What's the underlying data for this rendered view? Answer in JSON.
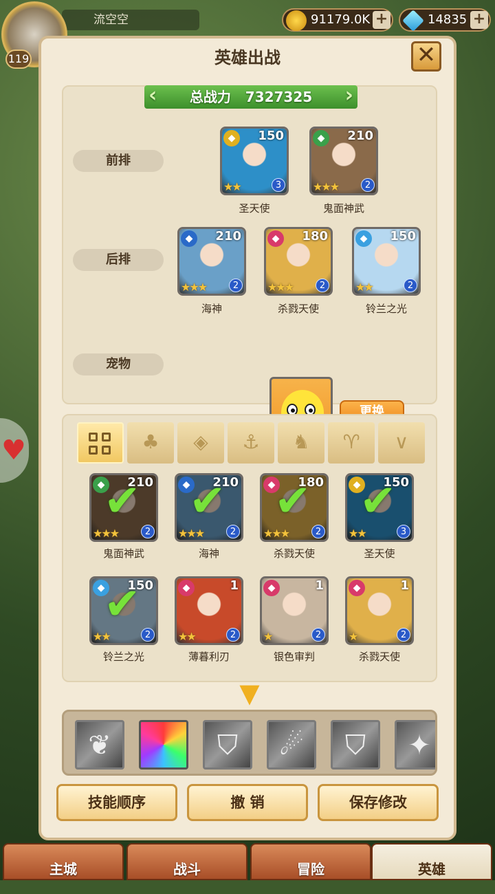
{
  "player": {
    "name": "流空空",
    "level": "119"
  },
  "resources": {
    "gold": "91179.0K",
    "gems": "14835"
  },
  "dialog": {
    "title": "英雄出战",
    "close_icon": "close-icon"
  },
  "power": {
    "label": "总战力",
    "value": "7327325"
  },
  "rows": {
    "front": "前排",
    "back": "后排",
    "pet": "宠物"
  },
  "front_row": [
    {
      "name": "圣天使",
      "level": "150",
      "element": "chevron",
      "stars": "★★",
      "badge": "3",
      "color": "#2d8fc8"
    },
    {
      "name": "鬼面神武",
      "level": "210",
      "element": "beast",
      "stars": "★★★",
      "badge": "2",
      "color": "#8a6a4a"
    }
  ],
  "back_row": [
    {
      "name": "海神",
      "level": "210",
      "element": "anchor",
      "stars": "★★★",
      "badge": "2",
      "color": "#6aa0c8"
    },
    {
      "name": "杀戮天使",
      "level": "180",
      "element": "flower",
      "stars": "★★★",
      "badge": "2",
      "color": "#e0b04a"
    },
    {
      "name": "铃兰之光",
      "level": "150",
      "element": "diamond",
      "stars": "★★",
      "badge": "2",
      "color": "#b6d8f0"
    }
  ],
  "pet": {
    "stars": "★",
    "swap_label": "更换"
  },
  "filter_tabs": [
    "all",
    "leaf",
    "diamond",
    "anchor",
    "beast",
    "horns",
    "chevron"
  ],
  "roster": [
    {
      "name": "鬼面神武",
      "level": "210",
      "stars": "★★★",
      "badge": "2",
      "selected": true,
      "color": "#8a6a4a",
      "element": "#3aa04a"
    },
    {
      "name": "海神",
      "level": "210",
      "stars": "★★★",
      "badge": "2",
      "selected": true,
      "color": "#6aa0c8",
      "element": "#2a6ac8"
    },
    {
      "name": "杀戮天使",
      "level": "180",
      "stars": "★★★",
      "badge": "2",
      "selected": true,
      "color": "#e0b04a",
      "element": "#d83a6a"
    },
    {
      "name": "圣天使",
      "level": "150",
      "stars": "★★",
      "badge": "3",
      "selected": true,
      "color": "#2d8fc8",
      "element": "#e0b020"
    },
    {
      "name": "铃兰之光",
      "level": "150",
      "stars": "★★",
      "badge": "2",
      "selected": true,
      "color": "#b6d8f0",
      "element": "#3aa0e0"
    },
    {
      "name": "薄暮利刃",
      "level": "1",
      "stars": "★★",
      "badge": "2",
      "selected": false,
      "color": "#c84a2a",
      "element": "#d83a6a"
    },
    {
      "name": "银色审判",
      "level": "1",
      "stars": "★",
      "badge": "2",
      "selected": false,
      "color": "#c8b6a0",
      "element": "#d83a6a"
    },
    {
      "name": "杀戮天使",
      "level": "1",
      "stars": "★",
      "badge": "2",
      "selected": false,
      "color": "#e0b04a",
      "element": "#d83a6a"
    }
  ],
  "skills": [
    "wing-skill",
    "prism-skill",
    "shield-skill",
    "slash-skill",
    "shield-skill",
    "strike-skill"
  ],
  "buttons": {
    "skill_order": "技能顺序",
    "undo": "撤 销",
    "save": "保存修改"
  },
  "nav": {
    "main_city": "主城",
    "battle": "战斗",
    "adventure": "冒险",
    "heroes": "英雄"
  },
  "colors": {
    "accent": "#f0b020",
    "power_bar": "#4fa83a",
    "panel": "#f3ead7"
  }
}
